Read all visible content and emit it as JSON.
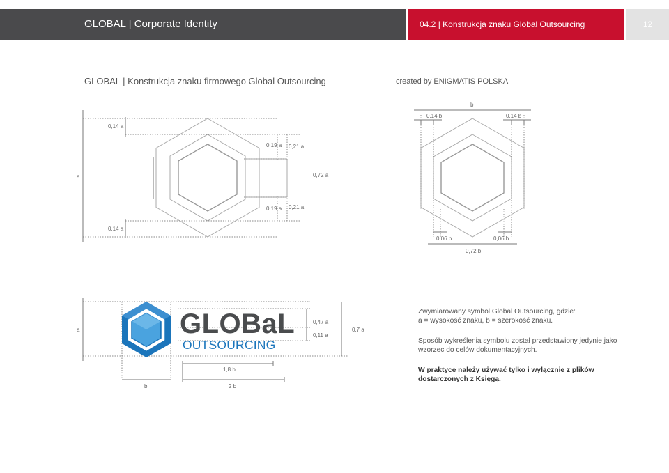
{
  "header": {
    "title": "GLOBAL | Corporate Identity",
    "section": "04.2 | Konstrukcja znaku Global Outsourcing",
    "page_number": "12"
  },
  "subtitle": {
    "left": "GLOBAL | Konstrukcja znaku firmowego Global Outsourcing",
    "right": "created by ENIGMATIS POLSKA"
  },
  "diagram_left": {
    "labels": {
      "top_014": "0,14 a",
      "top_019": "0,19 a",
      "top_021": "0,21 a",
      "a": "a",
      "mid_072": "0,72 a",
      "bot_019": "0,19 a",
      "bot_021": "0,21 a",
      "bot_014": "0,14 a"
    }
  },
  "diagram_right": {
    "labels": {
      "b": "b",
      "top_014_left": "0,14 b",
      "top_014_right": "0,14 b",
      "bot_006_left": "0,06 b",
      "bot_006_right": "0,06 b",
      "bot_072": "0,72 b"
    }
  },
  "logo": {
    "word_top": "GLOBaL",
    "word_bottom": "OUTSOURCING",
    "colors": {
      "gray": "#4a4c4e",
      "blue": "#1b75bb",
      "light_blue": "#4aa3df"
    },
    "labels": {
      "a": "a",
      "l047": "0,47 a",
      "l011": "0,11 a",
      "l07": "0,7 a",
      "l18b": "1,8 b",
      "b": "b",
      "l2b": "2 b"
    }
  },
  "description": {
    "p1": "Zwymiarowany symbol Global Outsourcing, gdzie:\na = wysokość znaku, b = szerokość znaku.",
    "p2": "Sposób wykreślenia symbolu został przedstawiony jedynie jako wzorzec do celów dokumentacyjnych.",
    "p3": "W praktyce należy używać tylko i wyłącznie z plików dostarczonych z Księgą."
  },
  "colors": {
    "header_dark": "#4a4a4c",
    "header_red": "#c8102e",
    "header_light": "#e3e3e3"
  }
}
